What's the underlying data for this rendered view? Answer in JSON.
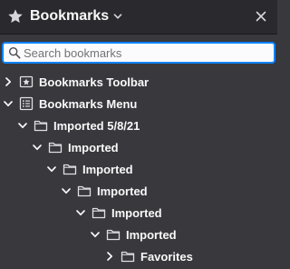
{
  "header": {
    "title": "Bookmarks",
    "title_icon": "star-icon",
    "menu_icon": "chevron-down-icon",
    "close_icon": "close-icon"
  },
  "search": {
    "placeholder": "Search bookmarks",
    "value": ""
  },
  "tree": {
    "items": [
      {
        "label": "Bookmarks Toolbar",
        "icon": "bookmarks-toolbar-icon",
        "expanded": false,
        "depth": 0
      },
      {
        "label": "Bookmarks Menu",
        "icon": "bookmarks-menu-icon",
        "expanded": true,
        "depth": 0
      },
      {
        "label": "Imported 5/8/21",
        "icon": "folder-icon",
        "expanded": true,
        "depth": 1
      },
      {
        "label": "Imported",
        "icon": "folder-icon",
        "expanded": true,
        "depth": 2
      },
      {
        "label": "Imported",
        "icon": "folder-icon",
        "expanded": true,
        "depth": 3
      },
      {
        "label": "Imported",
        "icon": "folder-icon",
        "expanded": true,
        "depth": 4
      },
      {
        "label": "Imported",
        "icon": "folder-icon",
        "expanded": true,
        "depth": 5
      },
      {
        "label": "Imported",
        "icon": "folder-icon",
        "expanded": true,
        "depth": 6
      },
      {
        "label": "Favorites",
        "icon": "folder-icon",
        "expanded": false,
        "depth": 7
      }
    ]
  },
  "colors": {
    "background": "#38383d",
    "header": "#2a2a2e",
    "accent": "#0a84ff",
    "text": "#f9f9fa"
  }
}
